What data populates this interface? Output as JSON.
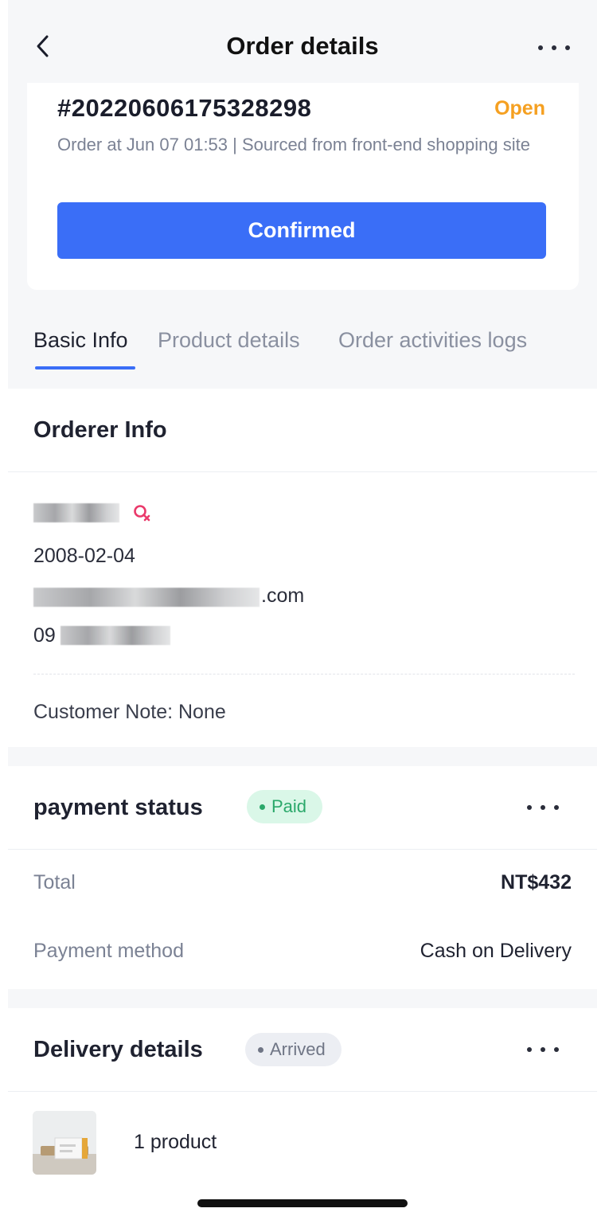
{
  "header": {
    "back_icon": "chevron-left-icon",
    "title": "Order details",
    "more_icon": "more-horizontal-icon"
  },
  "order": {
    "number": "#20220606175328298",
    "status": "Open",
    "status_color": "#f5a021",
    "meta": "Order at Jun 07 01:53  | Sourced from front-end shopping site",
    "confirm_label": "Confirmed",
    "accent_color": "#3a6ef7"
  },
  "tabs": [
    {
      "label": "Basic Info",
      "active": true
    },
    {
      "label": "Product details",
      "active": false
    },
    {
      "label": "Order activities logs",
      "active": false
    }
  ],
  "orderer": {
    "title": "Orderer Info",
    "gender_icon": "female-icon",
    "birthday": "2008-02-04",
    "email_suffix": ".com",
    "phone_prefix": "09",
    "customer_note": "Customer Note: None"
  },
  "payment": {
    "title": "payment status",
    "badge": "Paid",
    "total_label": "Total",
    "total_value": "NT$432",
    "method_label": "Payment method",
    "method_value": "Cash on Delivery"
  },
  "delivery": {
    "title": "Delivery details",
    "badge": "Arrived",
    "product_count": "1 product"
  }
}
